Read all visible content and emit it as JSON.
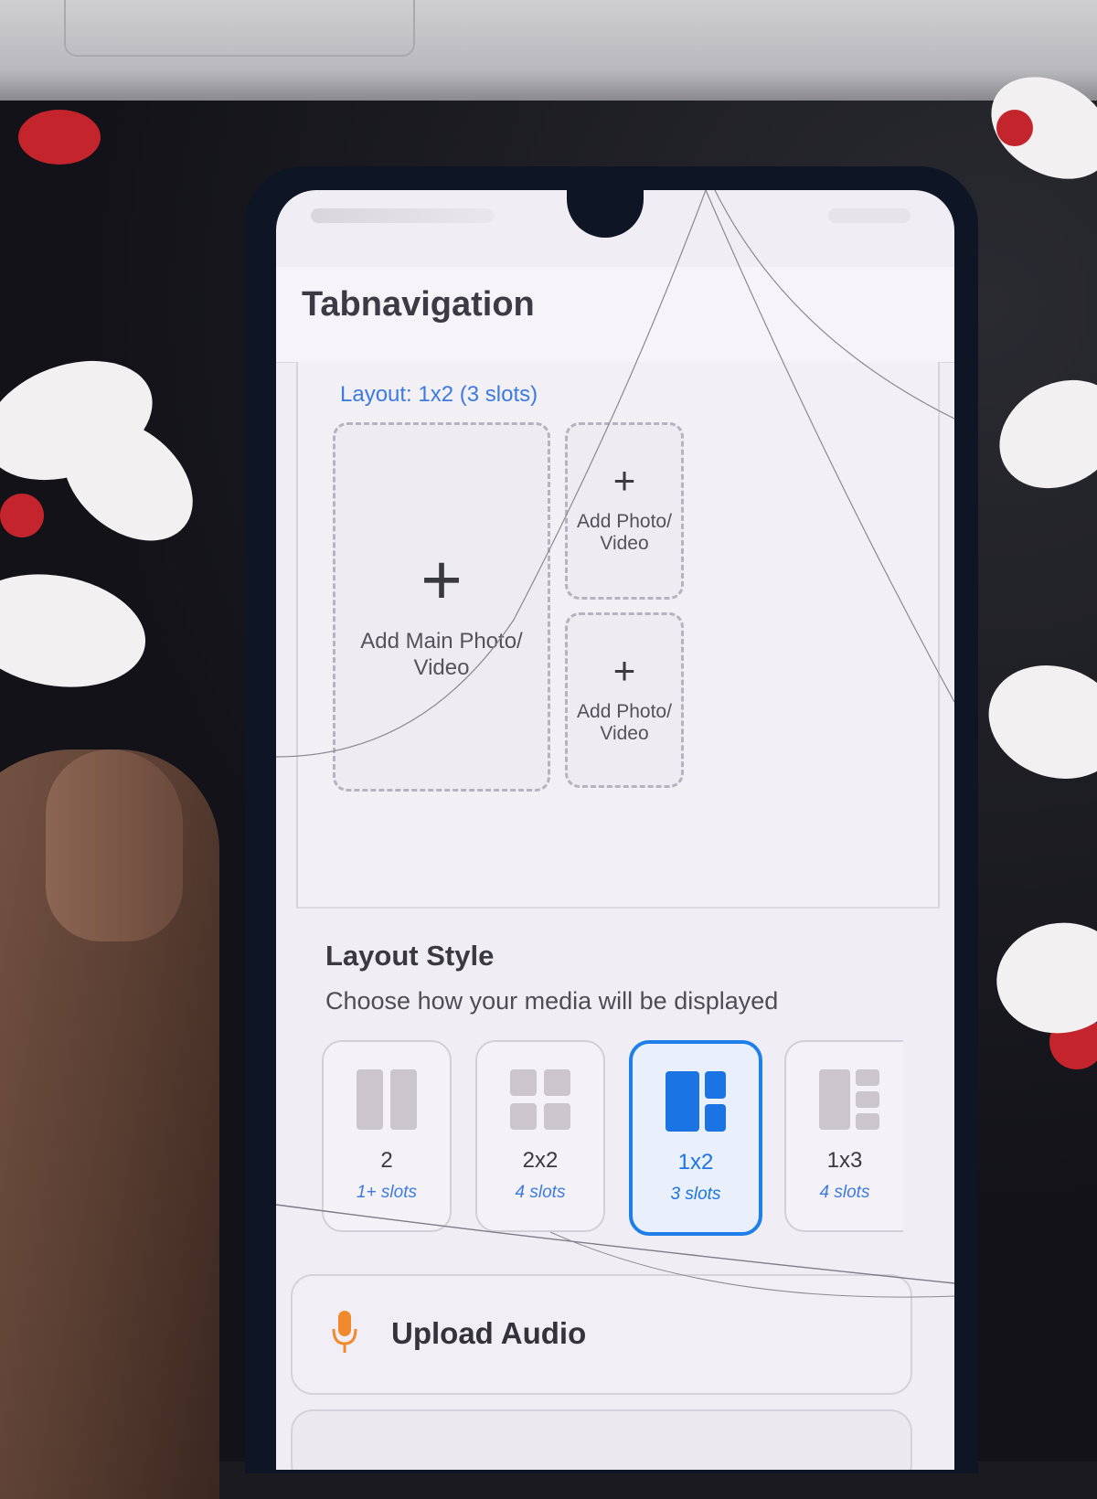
{
  "app": {
    "title": "Tabnavigation"
  },
  "preview": {
    "layout_label": "Layout: 1x2 (3 slots)",
    "main_slot": {
      "icon": "plus-icon",
      "label": "Add Main Photo/ Video"
    },
    "side_slots": [
      {
        "icon": "plus-icon",
        "label": "Add Photo/ Video"
      },
      {
        "icon": "plus-icon",
        "label": "Add Photo/ Video"
      }
    ]
  },
  "layout_style": {
    "title": "Layout Style",
    "subtitle": "Choose how your media will be displayed",
    "options": [
      {
        "name": "2",
        "slots": "1+ slots",
        "icon": "two-column-icon",
        "selected": false
      },
      {
        "name": "2x2",
        "slots": "4 slots",
        "icon": "grid-2x2-icon",
        "selected": false
      },
      {
        "name": "1x2",
        "slots": "3 slots",
        "icon": "one-plus-two-icon",
        "selected": true
      },
      {
        "name": "1x3",
        "slots": "4 slots",
        "icon": "one-plus-three-icon",
        "selected": false
      }
    ]
  },
  "upload_audio": {
    "label": "Upload Audio",
    "icon": "microphone-icon"
  },
  "colors": {
    "accent": "#1b74e4",
    "link_blue": "#3d7ae0",
    "mic_orange": "#f08a2c",
    "screen_bg": "#f0eef4"
  }
}
